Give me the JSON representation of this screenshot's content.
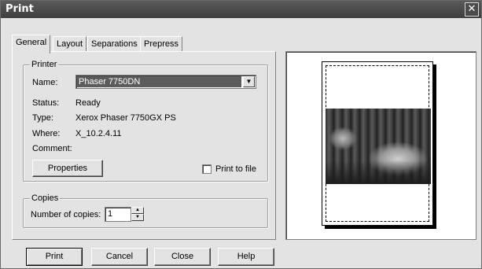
{
  "window": {
    "title": "Print",
    "close_glyph": "✕"
  },
  "tabs": [
    {
      "label": "General",
      "active": true
    },
    {
      "label": "Layout",
      "active": false
    },
    {
      "label": "Separations",
      "active": false
    },
    {
      "label": "Prepress",
      "active": false
    }
  ],
  "printer": {
    "group_label": "Printer",
    "name_label": "Name:",
    "name_value": "Phaser 7750DN",
    "status_label": "Status:",
    "status_value": "Ready",
    "type_label": "Type:",
    "type_value": "Xerox Phaser 7750GX PS",
    "where_label": "Where:",
    "where_value": "X_10.2.4.11",
    "comment_label": "Comment:",
    "comment_value": "",
    "properties_button": "Properties",
    "print_to_file_label": "Print to file",
    "print_to_file_checked": false
  },
  "copies": {
    "group_label": "Copies",
    "number_label": "Number of copies:",
    "number_value": "1"
  },
  "buttons": {
    "print": "Print",
    "cancel": "Cancel",
    "close": "Close",
    "help": "Help"
  },
  "icons": {
    "dropdown": "chevron-down-icon",
    "spin_up": "spin-up-icon",
    "spin_down": "spin-down-icon",
    "close": "close-icon"
  }
}
